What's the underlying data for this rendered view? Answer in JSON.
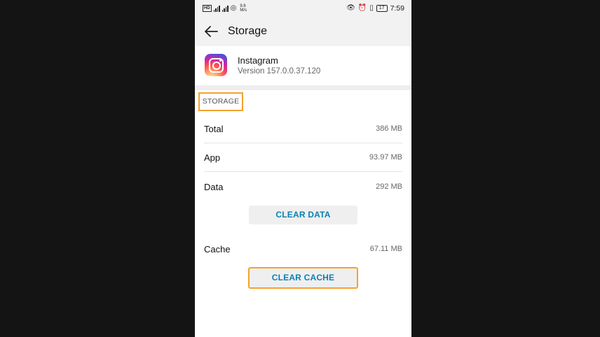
{
  "status_bar": {
    "network_badge": "HD",
    "speed_value": "9.6",
    "speed_unit": "M/s",
    "battery": "17",
    "time": "7:59"
  },
  "app_bar": {
    "title": "Storage",
    "back_icon": "arrow-left-icon"
  },
  "app_info": {
    "name": "Instagram",
    "version": "Version 157.0.0.37.120",
    "icon": "instagram-icon"
  },
  "storage": {
    "section_label": "STORAGE",
    "rows": [
      {
        "label": "Total",
        "value": "386 MB"
      },
      {
        "label": "App",
        "value": "93.97 MB"
      },
      {
        "label": "Data",
        "value": "292 MB"
      }
    ],
    "clear_data_label": "CLEAR DATA",
    "cache": {
      "label": "Cache",
      "value": "67.11 MB"
    },
    "clear_cache_label": "CLEAR CACHE"
  },
  "colors": {
    "accent_text": "#0a7fb5",
    "highlight_border": "#f4a22d",
    "background": "#141414"
  }
}
